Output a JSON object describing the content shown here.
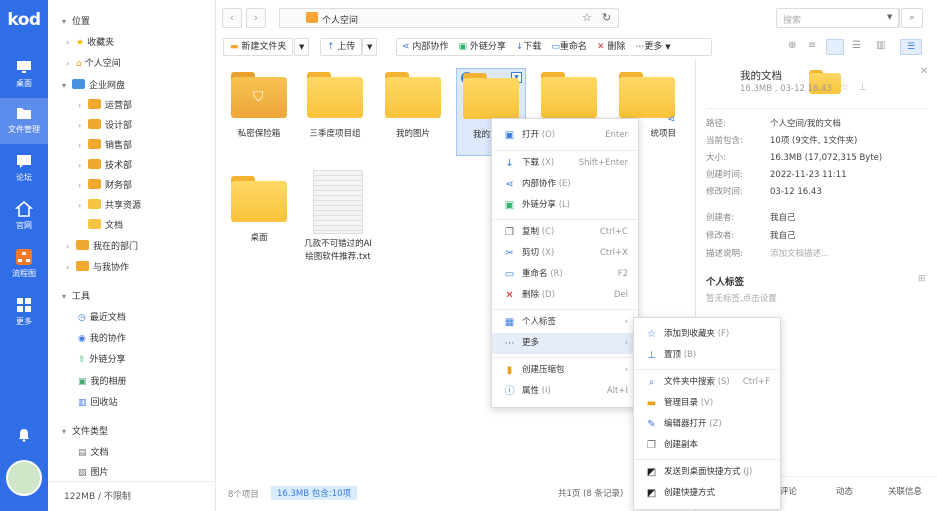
{
  "app": {
    "logo": "kod"
  },
  "rail": [
    {
      "label": "桌面",
      "icon": "monitor-icon"
    },
    {
      "label": "文件管理",
      "icon": "folder-icon"
    },
    {
      "label": "论坛",
      "icon": "chat-icon"
    },
    {
      "label": "官网",
      "icon": "home-icon"
    },
    {
      "label": "流程图",
      "icon": "flowchart-icon"
    },
    {
      "label": "更多",
      "icon": "grid-icon"
    }
  ],
  "tree": {
    "position": "位置",
    "favorites": "收藏夹",
    "personal": "个人空间",
    "enterprise": "企业网盘",
    "depts": [
      "运营部",
      "设计部",
      "销售部",
      "技术部",
      "财务部",
      "共享资源",
      "文档"
    ],
    "my_dept": "我在的部门",
    "collab": "与我协作",
    "tools": "工具",
    "tool_items": [
      "最近文档",
      "我的协作",
      "外链分享",
      "我的相册",
      "回收站"
    ],
    "filetypes": "文件类型",
    "filetype_items": [
      "文档",
      "图片"
    ],
    "storage": "122MB / 不限制"
  },
  "address": {
    "path": "个人空间",
    "search_placeholder": "搜索"
  },
  "toolbar": {
    "new_folder": "新建文件夹",
    "upload": "上传",
    "internal_collab": "内部协作",
    "external_share": "外链分享",
    "download": "下载",
    "rename": "重命名",
    "delete": "删除",
    "more": "更多"
  },
  "files": [
    {
      "name": "私密保险箱",
      "type": "safe"
    },
    {
      "name": "三季度项目组",
      "type": "folder"
    },
    {
      "name": "我的图片",
      "type": "folder"
    },
    {
      "name": "我的文档",
      "type": "folder"
    },
    {
      "name": "",
      "type": "folder"
    },
    {
      "name": "统项目",
      "type": "folder"
    },
    {
      "name": "桌面",
      "type": "folder"
    },
    {
      "name": "几款不可错过的AI绘图软件推荐.txt",
      "type": "txt"
    }
  ],
  "status": {
    "count": "8个项目",
    "selected": "16.3MB 包含:10项",
    "pages": "共1页 (8 条记录)"
  },
  "panel": {
    "title": "我的文档",
    "sub": "16.3MB , 03-12 16.43",
    "rows": [
      {
        "k": "路径:",
        "v": "个人空间/我的文档"
      },
      {
        "k": "当前包含:",
        "v": "10项 (9文件, 1文件夹)"
      },
      {
        "k": "大小:",
        "v": "16.3MB (17,072,315 Byte)"
      },
      {
        "k": "创建时间:",
        "v": "2022-11-23 11:11"
      },
      {
        "k": "修改时间:",
        "v": "03-12 16.43"
      },
      {
        "k": "创建者:",
        "v": "我自己"
      },
      {
        "k": "修改者:",
        "v": "我自己"
      },
      {
        "k": "描述说明:",
        "v": "添加文档描述..."
      }
    ],
    "tags_title": "个人标签",
    "tags_empty": "暂无标签,点击设置",
    "bottom_tabs": [
      "评论",
      "动态",
      "关联信息"
    ]
  },
  "ctx": [
    {
      "label": "打开",
      "hk": "(O)",
      "short": "Enter",
      "icon": "open-icon"
    },
    {
      "label": "下载",
      "hk": "(X)",
      "short": "Shift+Enter",
      "icon": "download-icon"
    },
    {
      "label": "内部协作",
      "hk": "(E)",
      "short": "",
      "icon": "share-icon"
    },
    {
      "label": "外链分享",
      "hk": "(L)",
      "short": "",
      "icon": "link-share-icon"
    },
    {
      "label": "复制",
      "hk": "(C)",
      "short": "Ctrl+C",
      "icon": "copy-icon"
    },
    {
      "label": "剪切",
      "hk": "(X)",
      "short": "Ctrl+X",
      "icon": "cut-icon"
    },
    {
      "label": "重命名",
      "hk": "(R)",
      "short": "F2",
      "icon": "rename-icon"
    },
    {
      "label": "删除",
      "hk": "(D)",
      "short": "Del",
      "icon": "delete-icon"
    },
    {
      "label": "个人标签",
      "hk": "",
      "short": "",
      "icon": "tag-icon"
    },
    {
      "label": "更多",
      "hk": "",
      "short": "",
      "icon": "more-icon"
    },
    {
      "label": "创建压缩包",
      "hk": "",
      "short": "",
      "icon": "zip-icon"
    },
    {
      "label": "属性",
      "hk": "(I)",
      "short": "Alt+I",
      "icon": "info-icon"
    }
  ],
  "sub": [
    {
      "label": "添加到收藏夹",
      "hk": "(F)",
      "short": "",
      "icon": "star-icon"
    },
    {
      "label": "置顶",
      "hk": "(B)",
      "short": "",
      "icon": "pin-icon"
    },
    {
      "label": "文件夹中搜索",
      "hk": "(S)",
      "short": "Ctrl+F",
      "icon": "search-icon"
    },
    {
      "label": "管理目录",
      "hk": "(V)",
      "short": "",
      "icon": "folder-manage-icon"
    },
    {
      "label": "编辑器打开",
      "hk": "(Z)",
      "short": "",
      "icon": "editor-icon"
    },
    {
      "label": "创建副本",
      "hk": "",
      "short": "",
      "icon": "duplicate-icon"
    },
    {
      "label": "发送到桌面快捷方式",
      "hk": "(J)",
      "short": "",
      "icon": "desktop-shortcut-icon"
    },
    {
      "label": "创建快捷方式",
      "hk": "",
      "short": "",
      "icon": "shortcut-icon"
    }
  ]
}
